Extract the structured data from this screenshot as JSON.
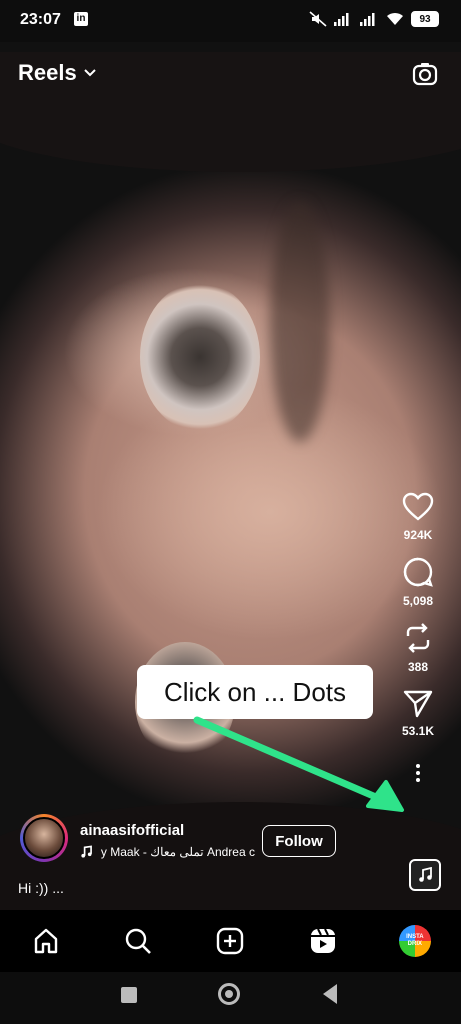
{
  "status_bar": {
    "time": "23:07",
    "app_badge": "in",
    "battery": "93"
  },
  "header": {
    "title": "Reels"
  },
  "actions": {
    "likes": "924K",
    "comments": "5,098",
    "reposts": "388",
    "shares": "53.1K"
  },
  "annotation": {
    "text": "Click on ... Dots",
    "color": "#2fe38a"
  },
  "post": {
    "username": "ainaasifofficial",
    "audio": "y Maak - تملى معاك    Andrea c",
    "follow_label": "Follow",
    "caption": "Hi :)) ..."
  },
  "nav": {
    "profile_badge": "INSTA DRIX"
  },
  "icons": [
    "camera-icon",
    "heart-icon",
    "comment-icon",
    "repost-icon",
    "share-icon",
    "more-dots-icon",
    "music-note-icon",
    "home-icon",
    "search-icon",
    "create-icon",
    "reels-icon"
  ]
}
